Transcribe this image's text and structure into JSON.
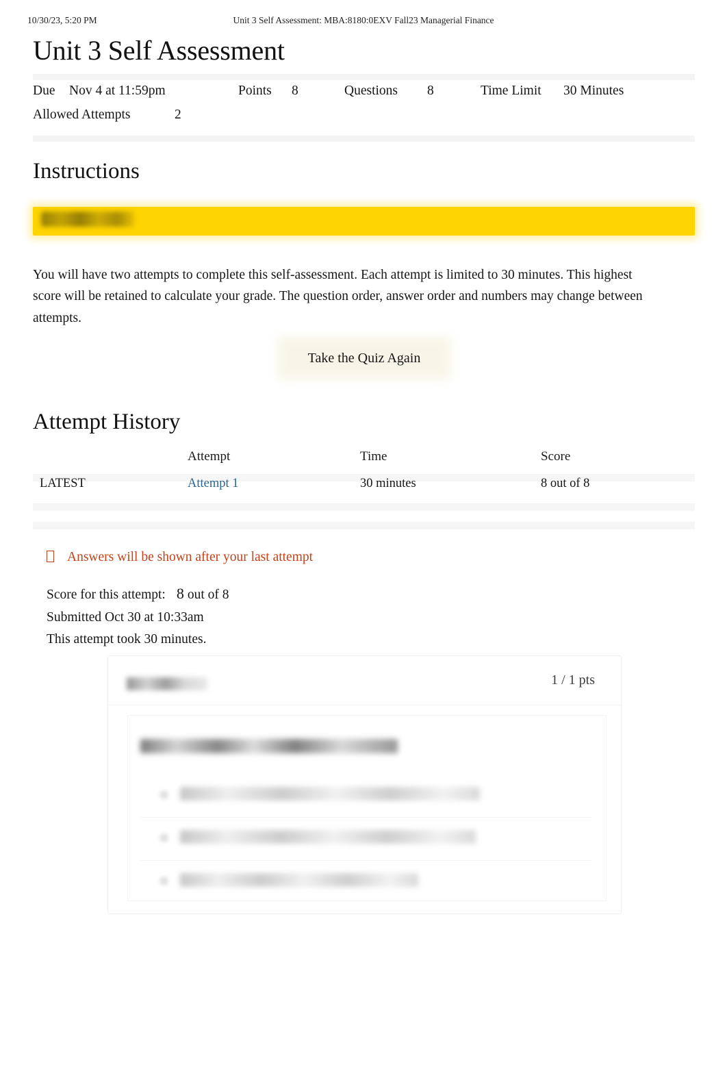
{
  "print_header": {
    "date": "10/30/23, 5:20 PM",
    "doc_title": "Unit 3 Self Assessment: MBA:8180:0EXV Fall23 Managerial Finance"
  },
  "page": {
    "title": "Unit 3 Self Assessment"
  },
  "meta": {
    "due_label": "Due",
    "due_value": "Nov 4 at 11:59pm",
    "points_label": "Points",
    "points_value": "8",
    "questions_label": "Questions",
    "questions_value": "8",
    "time_limit_label": "Time Limit",
    "time_limit_value": "30 Minutes",
    "allowed_attempts_label": "Allowed Attempts",
    "allowed_attempts_value": "2"
  },
  "instructions": {
    "heading": "Instructions",
    "highlight_text": "",
    "body": "You will have two attempts to complete this self-assessment. Each attempt is limited to 30 minutes. This highest score will be retained to calculate your grade. The question order, answer order and numbers may change between attempts."
  },
  "actions": {
    "retake_label": "Take the Quiz Again"
  },
  "attempt_history": {
    "heading": "Attempt History",
    "columns": {
      "kept": "",
      "attempt": "Attempt",
      "time": "Time",
      "score": "Score"
    },
    "rows": [
      {
        "kept": "LATEST",
        "attempt": "Attempt 1",
        "time": "30 minutes",
        "score": "8 out of 8"
      }
    ]
  },
  "attempt_detail": {
    "answers_note": "Answers will be shown after your last attempt",
    "score_label": "Score for this attempt:",
    "score_value": "8",
    "score_suffix": "out of 8",
    "submitted": "Submitted Oct 30 at 10:33am",
    "duration": "This attempt took 30 minutes."
  },
  "question": {
    "label": "",
    "points": "1 / 1 pts",
    "text": "",
    "options": [
      "",
      "",
      ""
    ]
  },
  "colors": {
    "highlight": "#ffd400",
    "link": "#2a6496",
    "warning": "#c4421a",
    "text": "#161616",
    "background": "#ffffff"
  }
}
